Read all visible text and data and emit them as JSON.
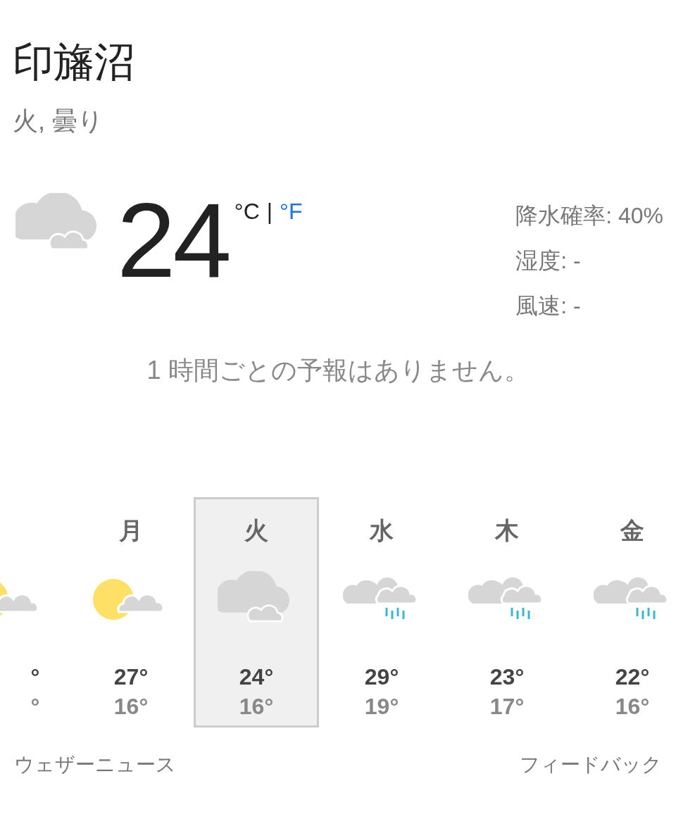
{
  "location": "印旛沼",
  "summary": "火, 曇り",
  "current": {
    "kind": "cloudy",
    "temp": "24",
    "separator": "|",
    "units": [
      {
        "label": "°C",
        "selected": true
      },
      {
        "label": "°F",
        "selected": false
      }
    ]
  },
  "details": [
    "降水確率: 40%",
    "湿度: -",
    "風速: -"
  ],
  "hourly_message": "1 時間ごとの予報はありません。",
  "days": [
    {
      "kind": "partly_sunny",
      "high": "°",
      "low": "°",
      "selected": false
    },
    {
      "day": "月",
      "kind": "partly_sunny",
      "high": "27°",
      "low": "16°",
      "selected": false
    },
    {
      "day": "火",
      "kind": "cloudy",
      "high": "24°",
      "low": "16°",
      "selected": true
    },
    {
      "day": "水",
      "kind": "rain",
      "high": "29°",
      "low": "19°",
      "selected": false
    },
    {
      "day": "木",
      "kind": "rain",
      "high": "23°",
      "low": "17°",
      "selected": false
    },
    {
      "day": "金",
      "kind": "rain",
      "high": "22°",
      "low": "16°",
      "selected": false
    }
  ],
  "footer": {
    "left": "ウェザーニュース",
    "right": "フィードバック"
  }
}
